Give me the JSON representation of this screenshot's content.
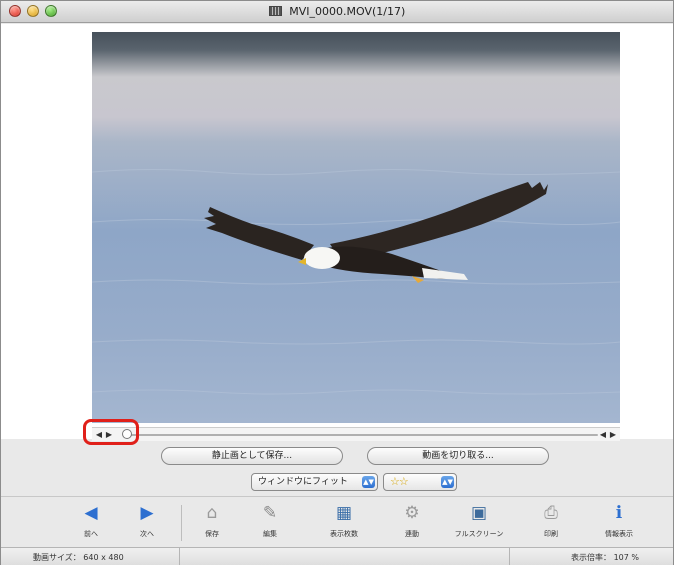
{
  "window": {
    "title": "MVI_0000.MOV(1/17)",
    "icon": "movie-file-icon"
  },
  "player": {
    "prev_frame_icon": "step-back-icon",
    "play_icon": "play-icon",
    "next_frame_icon": "step-forward-icon",
    "end_icon": "skip-end-icon",
    "position_fraction": 0.0
  },
  "actions": {
    "save_still_label": "静止画として保存...",
    "cut_movie_label": "動画を切り取る..."
  },
  "view": {
    "fit_option": "ウィンドウにフィット",
    "rating": "☆☆"
  },
  "toolbar": {
    "items": [
      {
        "label": "前へ",
        "icon": "◀"
      },
      {
        "label": "次へ",
        "icon": "▶"
      },
      {
        "label": "保存",
        "icon": "⌂"
      },
      {
        "label": "編集",
        "icon": "✎"
      },
      {
        "label": "表示枚数",
        "icon": "▦"
      },
      {
        "label": "連動",
        "icon": "⚙"
      },
      {
        "label": "フルスクリーン",
        "icon": "▣"
      },
      {
        "label": "印刷",
        "icon": "⎙"
      },
      {
        "label": "情報表示",
        "icon": "ℹ"
      }
    ]
  },
  "status": {
    "movie_size": "動画サイズ： 640 x 480",
    "zoom": "表示倍率： 107 %"
  },
  "colors": {
    "highlight": "#e0201a",
    "accent": "#2d6fd0"
  }
}
